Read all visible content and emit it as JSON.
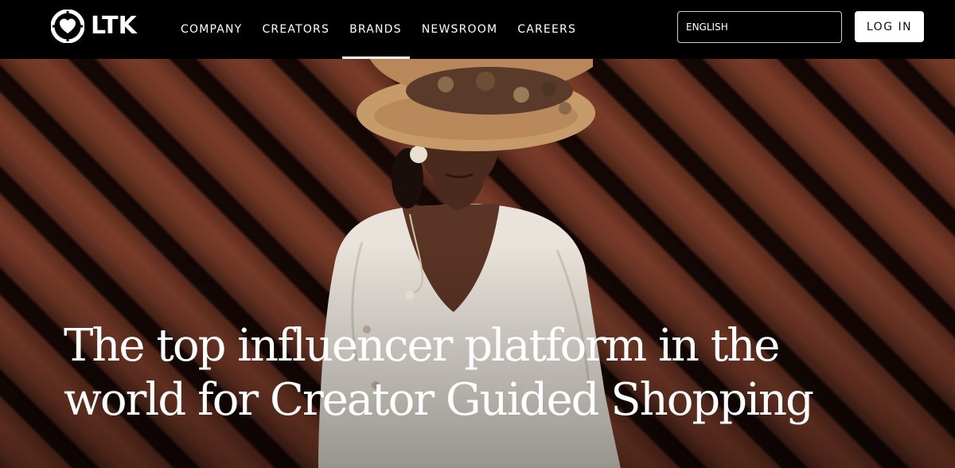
{
  "header": {
    "logo_text": "LTK",
    "nav": [
      {
        "label": "COMPANY",
        "active": false
      },
      {
        "label": "CREATORS",
        "active": false
      },
      {
        "label": "BRANDS",
        "active": true
      },
      {
        "label": "NEWSROOM",
        "active": false
      },
      {
        "label": "CAREERS",
        "active": false
      }
    ],
    "language": "ENGLISH",
    "login_label": "LOG IN"
  },
  "hero": {
    "headline": "The top influencer platform in the world for Creator Guided Shopping"
  },
  "colors": {
    "topbar": "#000000",
    "wood": "#6e3525",
    "headline": "#ffffff"
  }
}
